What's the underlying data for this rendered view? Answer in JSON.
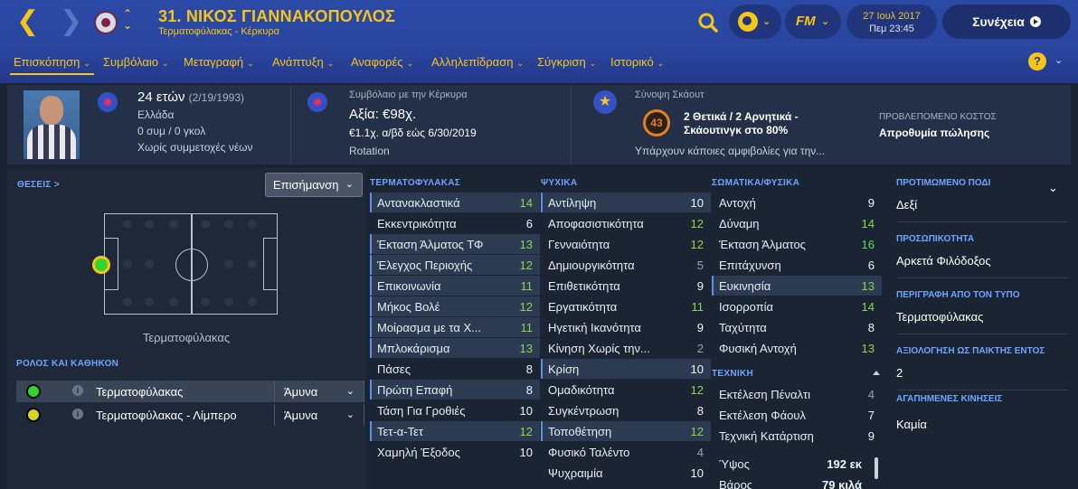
{
  "header": {
    "player_title": "31. ΝΙΚΟΣ ΓΙΑΝΝΑΚΟΠΟΥΛΟΣ",
    "player_sub": "Τερματοφύλακας - Κέρκυρα",
    "date": "27 Ιουλ 2017",
    "time": "Πεμ 23:45",
    "continue_label": "Συνέχεια",
    "fm_label": "FM"
  },
  "nav": {
    "items": [
      {
        "label": "Επισκόπηση"
      },
      {
        "label": "Συμβόλαιο"
      },
      {
        "label": "Μεταγραφή"
      },
      {
        "label": "Ανάπτυξη"
      },
      {
        "label": "Αναφορές"
      },
      {
        "label": "Αλληλεπίδραση"
      },
      {
        "label": "Σύγκριση"
      },
      {
        "label": "Ιστορικό"
      }
    ],
    "help_label": "?"
  },
  "info": {
    "age": "24 ετών",
    "dob": "(2/19/1993)",
    "nation": "Ελλάδα",
    "caps": "0 συμ / 0 γκολ",
    "youth": "Χωρίς συμμετοχές νέων",
    "contract_label": "Συμβόλαιο με την Κέρκυρα",
    "value": "Αξία: €98χ.",
    "wage": "€1.1χ. α/βδ εώς 6/30/2019",
    "squad_status": "Rotation",
    "scout_label": "Σύνοψη Σκάουτ",
    "scout_score": "43",
    "scout_summary": "2 Θετικά / 2 Αρνητικά - Σκάουτινγκ στο 80%",
    "scout_doubt": "Υπάρχουν κάποιες αμφιβολίες για την...",
    "cost_label": "ΠΡΟΒΛΕΠΟΜΕΝΟ ΚΟΣΤΟΣ",
    "cost_value": "Απροθυμία πώλησης"
  },
  "left": {
    "positions_label": "ΘΕΣΕΙΣ >",
    "highlight_label": "Επισήμανση",
    "pitch_caption": "Τερματοφύλακας",
    "roles_label": "ΡΟΛΟΣ ΚΑΙ ΚΑΘΗΚΟΝ",
    "roles": [
      {
        "name": "Τερματοφύλακας",
        "duty": "Άμυνα",
        "color": "#31d531"
      },
      {
        "name": "Τερματοφύλακας - Λίμπερο",
        "duty": "Άμυνα",
        "color": "#d6d61e"
      }
    ]
  },
  "colors": {
    "accent": "#f5c518",
    "section_label": "#6fa4ff",
    "attr_good": "#8ed44e",
    "attr_best": "#52e05a",
    "attr_dim": "#9aa3b0"
  },
  "attributes": {
    "goalkeeping": {
      "title": "ΤΕΡΜΑΤΟΦΥΛΑΚΑΣ",
      "rows": [
        {
          "name": "Αντανακλαστικά",
          "value": "14",
          "hl": true
        },
        {
          "name": "Εκκεντρικότητα",
          "value": "6",
          "hl": false
        },
        {
          "name": "Έκταση Άλματος ΤΦ",
          "value": "13",
          "hl": true
        },
        {
          "name": "Έλεγχος Περιοχής",
          "value": "12",
          "hl": true
        },
        {
          "name": "Επικοινωνία",
          "value": "11",
          "hl": true
        },
        {
          "name": "Μήκος Βολέ",
          "value": "12",
          "hl": true
        },
        {
          "name": "Μοίρασμα με τα Χ...",
          "value": "11",
          "hl": true
        },
        {
          "name": "Μπλοκάρισμα",
          "value": "13",
          "hl": true
        },
        {
          "name": "Πάσες",
          "value": "8",
          "hl": false
        },
        {
          "name": "Πρώτη Επαφή",
          "value": "8",
          "hl": true
        },
        {
          "name": "Τάση Για Γροθιές",
          "value": "10",
          "hl": false
        },
        {
          "name": "Τετ-α-Τετ",
          "value": "12",
          "hl": true
        },
        {
          "name": "Χαμηλή Έξοδος",
          "value": "10",
          "hl": false
        }
      ]
    },
    "mental": {
      "title": "ΨΥΧΙΚΑ",
      "rows": [
        {
          "name": "Αντίληψη",
          "value": "10",
          "hl": true
        },
        {
          "name": "Αποφασιστικότητα",
          "value": "12",
          "hl": false
        },
        {
          "name": "Γενναιότητα",
          "value": "12",
          "hl": false
        },
        {
          "name": "Δημιουργικότητα",
          "value": "5",
          "hl": false
        },
        {
          "name": "Επιθετικότητα",
          "value": "9",
          "hl": false
        },
        {
          "name": "Εργατικότητα",
          "value": "11",
          "hl": false
        },
        {
          "name": "Ηγετική Ικανότητα",
          "value": "9",
          "hl": false
        },
        {
          "name": "Κίνηση Χωρίς την...",
          "value": "2",
          "hl": false
        },
        {
          "name": "Κρίση",
          "value": "10",
          "hl": true
        },
        {
          "name": "Ομαδικότητα",
          "value": "12",
          "hl": false
        },
        {
          "name": "Συγκέντρωση",
          "value": "8",
          "hl": false
        },
        {
          "name": "Τοποθέτηση",
          "value": "12",
          "hl": true
        },
        {
          "name": "Φυσικό Ταλέντο",
          "value": "4",
          "hl": false
        },
        {
          "name": "Ψυχραιμία",
          "value": "10",
          "hl": false
        }
      ]
    },
    "physical": {
      "title": "ΣΩΜΑΤΙΚΑ/ΦΥΣΙΚΑ",
      "rows": [
        {
          "name": "Αντοχή",
          "value": "9",
          "hl": false
        },
        {
          "name": "Δύναμη",
          "value": "14",
          "hl": false
        },
        {
          "name": "Έκταση Άλματος",
          "value": "16",
          "hl": false
        },
        {
          "name": "Επιτάχυνση",
          "value": "6",
          "hl": false
        },
        {
          "name": "Ευκινησία",
          "value": "13",
          "hl": true
        },
        {
          "name": "Ισορροπία",
          "value": "14",
          "hl": false
        },
        {
          "name": "Ταχύτητα",
          "value": "8",
          "hl": false
        },
        {
          "name": "Φυσική Αντοχή",
          "value": "13",
          "hl": false
        }
      ]
    },
    "technical": {
      "title": "ΤΕΧΝΙΚΗ",
      "rows": [
        {
          "name": "Εκτέλεση Πέναλτι",
          "value": "4",
          "hl": false
        },
        {
          "name": "Εκτέλεση Φάουλ",
          "value": "7",
          "hl": false
        },
        {
          "name": "Τεχνική Κατάρτιση",
          "value": "9",
          "hl": false
        }
      ]
    },
    "body": [
      {
        "name": "Ύψος",
        "value": "192 εκ"
      },
      {
        "name": "Βάρος",
        "value": "79 κιλά"
      }
    ]
  },
  "right": {
    "foot_label": "ΠΡΟΤΙΜΩΜΕΝΟ ΠΟΔΙ",
    "foot_value": "Δεξί",
    "personality_label": "ΠΡΟΣΩΠΙΚΟΤΗΤΑ",
    "personality_value": "Αρκετά Φιλόδοξος",
    "media_label": "ΠΕΡΙΓΡΑΦΗ ΑΠΟ ΤΟΝ ΤΥΠΟ",
    "media_value": "Τερματοφύλακας",
    "rating_label": "ΑΞΙΟΛΟΓΗΣΗ ΩΣ ΠΑΙΚΤΗΣ ΕΝΤΟΣ",
    "rating_value": "2",
    "moves_label": "ΑΓΑΠΗΜΕΝΕΣ ΚΙΝΗΣΕΙΣ",
    "moves_value": "Καμία"
  }
}
